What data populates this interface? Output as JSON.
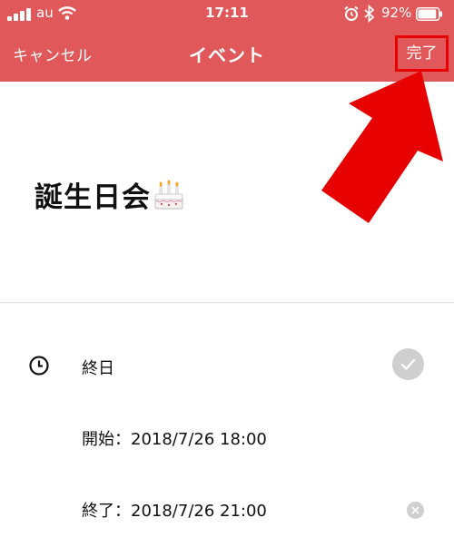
{
  "status_bar": {
    "carrier": "au",
    "time": "17:11",
    "battery_percent": "92%",
    "battery_level": 0.92,
    "icons": [
      "signal-icon",
      "wifi-icon",
      "alarm-icon",
      "bluetooth-icon",
      "battery-icon"
    ]
  },
  "nav": {
    "cancel_label": "キャンセル",
    "title": "イベント",
    "done_label": "完了"
  },
  "event": {
    "title": "誕生日会",
    "title_icon": "birthday-cake-icon"
  },
  "details": {
    "all_day_label": "終日",
    "all_day_toggle_icon": "checkmark-icon",
    "start": "開始：2018/7/26 18:00",
    "end": "終了：2018/7/26 21:00",
    "clear_end_icon": "close-icon"
  },
  "colors": {
    "header": "#e0585a",
    "annotation": "#e60000",
    "toggle_off": "#cfcfcf"
  }
}
